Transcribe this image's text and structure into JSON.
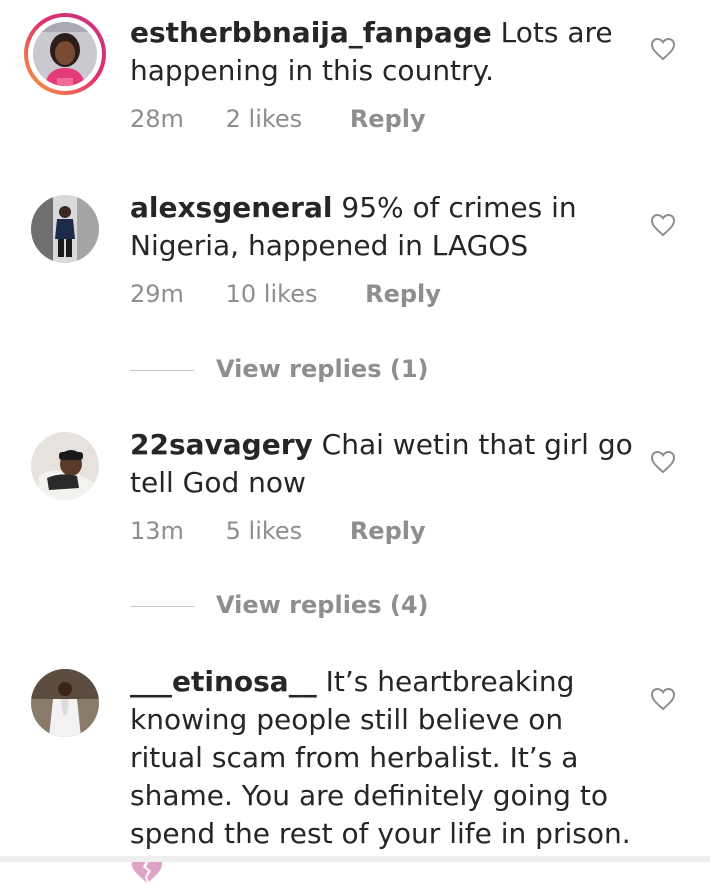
{
  "comments": [
    {
      "username": "estherbbnaija_fanpage",
      "text": "Lots are happening in this country.",
      "time": "28m",
      "likes": "2 likes",
      "reply": "Reply",
      "avatar_icon": "profile-photo-woman-pink"
    },
    {
      "username": "alexsgeneral",
      "text": "95% of crimes in Nigeria, happened in LAGOS",
      "time": "29m",
      "likes": "10 likes",
      "reply": "Reply",
      "view_replies": "View replies (1)",
      "avatar_icon": "profile-photo-man-standing"
    },
    {
      "username": "22savagery",
      "text": "Chai wetin that girl go tell God now",
      "time": "13m",
      "likes": "5 likes",
      "reply": "Reply",
      "view_replies": "View replies (4)",
      "avatar_icon": "profile-photo-man-cap"
    },
    {
      "username": "___etinosa__",
      "text": "It’s heartbreaking knowing people still believe on ritual scam from herbalist. It’s a shame. You are definitely going to spend the rest of your life in prison.",
      "avatar_icon": "profile-photo-man-white-outfit",
      "emoji": "broken-heart-icon"
    }
  ],
  "colors": {
    "text": "#262626",
    "secondary": "#8e8e8e",
    "heart_outline": "#8e8e8e",
    "story_ring_start": "#f9a23b",
    "story_ring_end": "#c13584",
    "broken_heart": "#e0a3c8"
  }
}
